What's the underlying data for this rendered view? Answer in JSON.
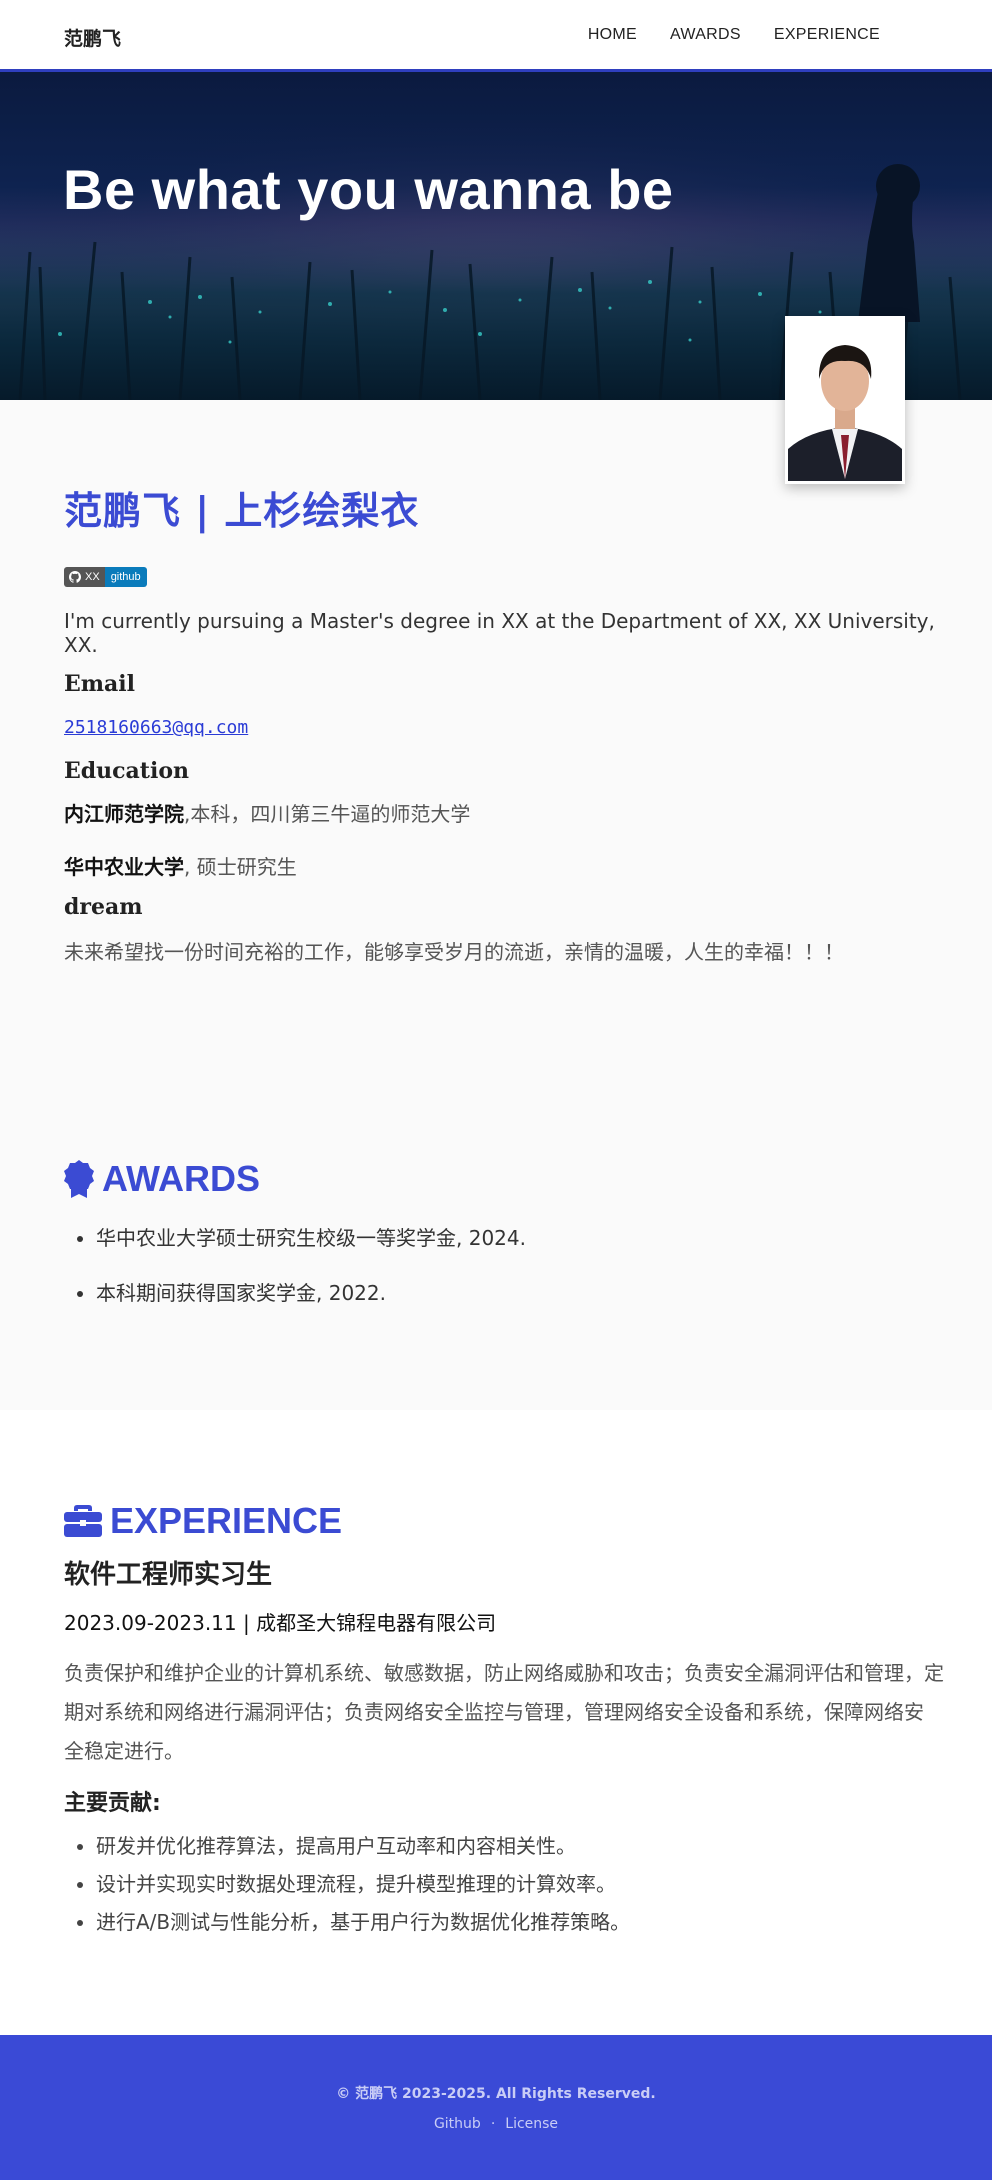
{
  "navbar": {
    "brand": "范鹏飞",
    "links": [
      "HOME",
      "AWARDS",
      "EXPERIENCE"
    ]
  },
  "hero": {
    "title": "Be what you wanna be"
  },
  "profile": {
    "name": "范鹏飞 | 上杉绘梨衣",
    "badge": {
      "left": "XX",
      "right": "github"
    },
    "intro": "I'm currently pursuing a Master's degree in XX at the Department of XX, XX University, XX.",
    "email_heading": "Email",
    "email": "2518160663@qq.com",
    "education_heading": "Education",
    "education": [
      {
        "school": "内江师范学院",
        "detail": ",本科，四川第三牛逼的师范大学"
      },
      {
        "school": "华中农业大学",
        "detail": ", 硕士研究生"
      }
    ],
    "dream_heading": "dream",
    "dream": "未来希望找一份时间充裕的工作，能够享受岁月的流逝，亲情的温暖，人生的幸福！！！"
  },
  "awards": {
    "title": "AWARDS",
    "items": [
      "华中农业大学硕士研究生校级一等奖学金, 2024.",
      "本科期间获得国家奖学金, 2022."
    ]
  },
  "experience": {
    "title": "EXPERIENCE",
    "job_title": "软件工程师实习生",
    "meta": "2023.09-2023.11 | 成都圣大锦程电器有限公司",
    "description": "负责保护和维护企业的计算机系统、敏感数据，防止网络威胁和攻击；负责安全漏洞评估和管理，定期对系统和网络进行漏洞评估；负责网络安全监控与管理，管理网络安全设备和系统，保障网络安 全稳定进行。",
    "contrib_heading": "主要贡献:",
    "contributions": [
      "研发并优化推荐算法，提高用户互动率和内容相关性。",
      "设计并实现实时数据处理流程，提升模型推理的计算效率。",
      "进行A/B测试与性能分析，基于用户行为数据优化推荐策略。"
    ]
  },
  "footer": {
    "copyright": "© 范鹏飞 2023-2025. All Rights Reserved.",
    "links": [
      "Github",
      "License"
    ],
    "separator": "·"
  },
  "colors": {
    "accent": "#3b4bd3",
    "footer_bg": "#3a4ad6",
    "link": "#2a3bd6"
  }
}
